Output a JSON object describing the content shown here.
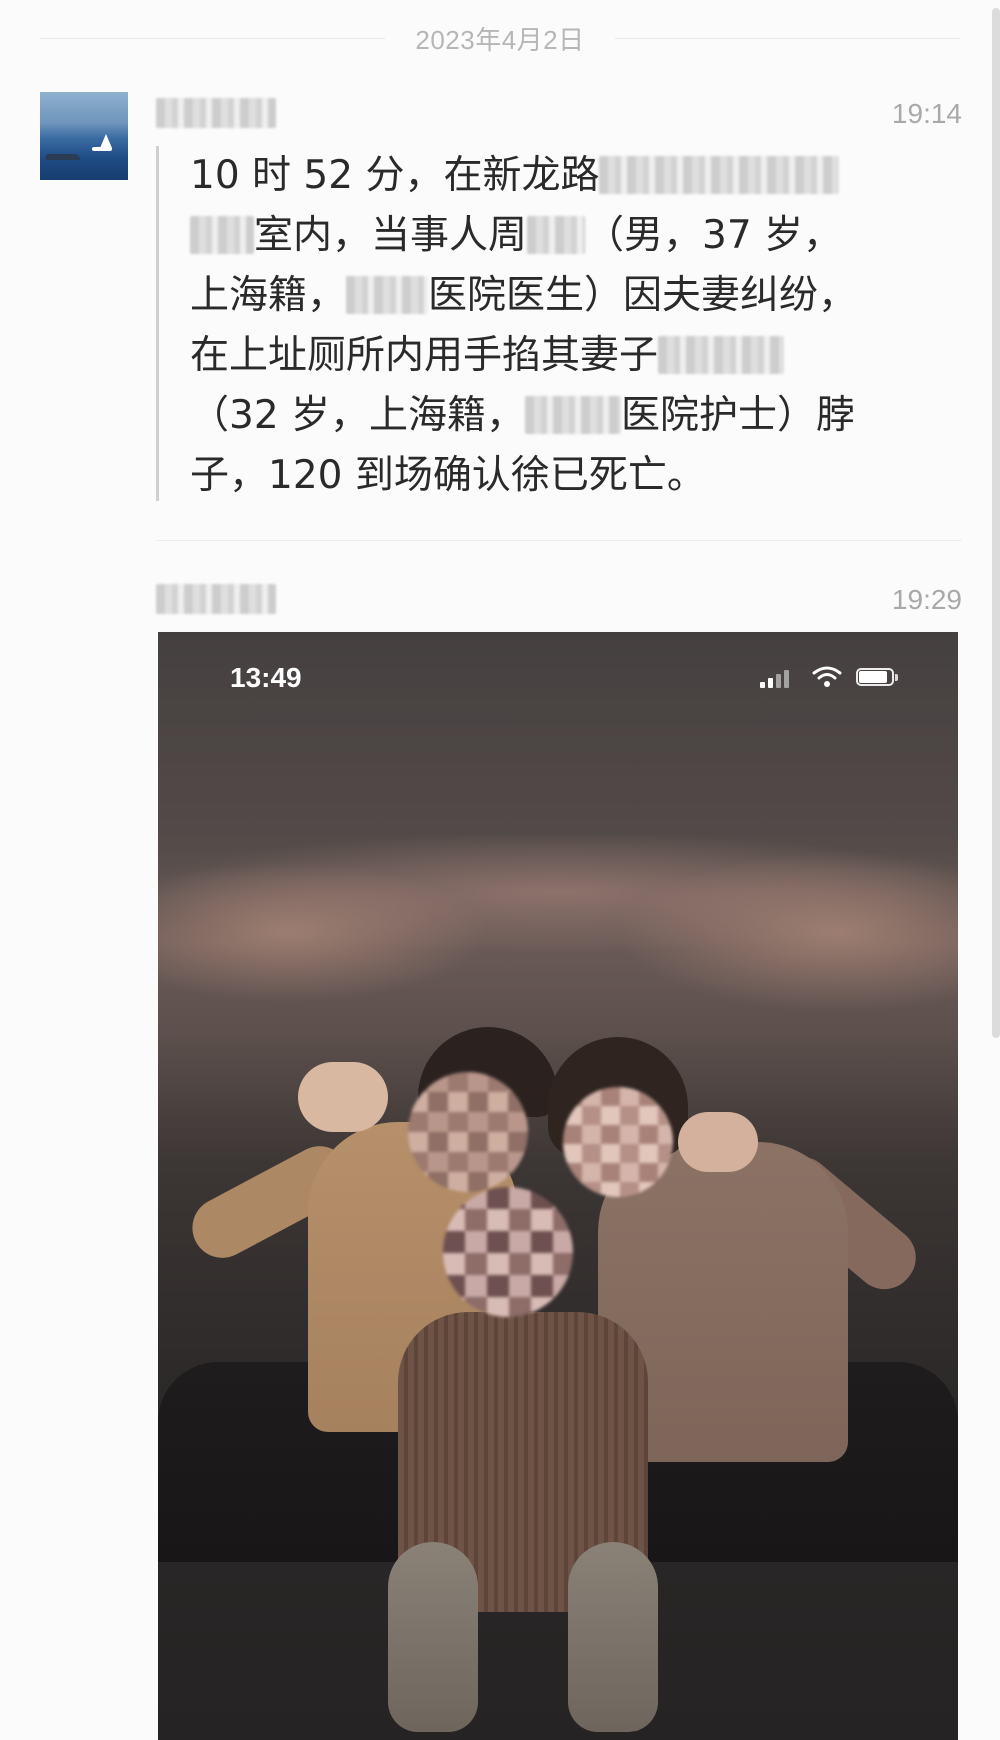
{
  "date_divider": "2023年4月2日",
  "messages": [
    {
      "time": "19:14",
      "lines": [
        {
          "text": "10 时 52 分，在新龙路",
          "tail": ""
        },
        {
          "text": "室内，当事人周",
          "tail": "（男，37 岁，"
        },
        {
          "text": "上海籍，",
          "tail": "医院医生）因夫妻纠纷，"
        },
        {
          "text": "在上址厕所内用手掐其妻子",
          "tail": ""
        },
        {
          "text": "（32 岁，上海籍，",
          "tail": "医院护士）脖"
        },
        {
          "text": "子，120 到场确认徐已死亡。",
          "tail": ""
        }
      ]
    },
    {
      "time": "19:29",
      "photo": {
        "status_time": "13:49",
        "icons": [
          "signal-icon",
          "wifi-icon",
          "battery-icon"
        ]
      }
    }
  ],
  "colors": {
    "background": "#fbfbfb",
    "text": "#2a2a2a",
    "meta": "#a9a9a9"
  }
}
